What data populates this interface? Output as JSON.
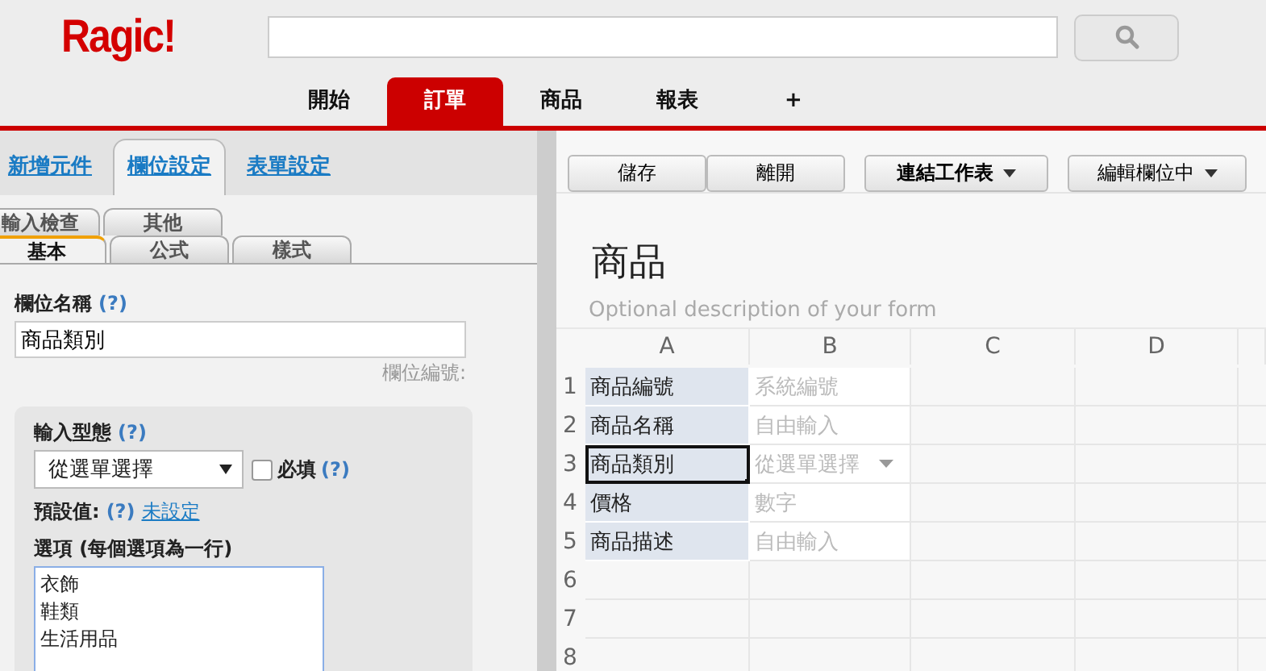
{
  "header": {
    "logo": "Ragic!"
  },
  "nav_tabs": [
    {
      "label": "開始",
      "selected": false
    },
    {
      "label": "訂單",
      "selected": true
    },
    {
      "label": "商品",
      "selected": false
    },
    {
      "label": "報表",
      "selected": false
    },
    {
      "label": "+",
      "selected": false
    }
  ],
  "left_panel": {
    "tabs": [
      {
        "label": "新增元件",
        "selected": false
      },
      {
        "label": "欄位設定",
        "selected": true
      },
      {
        "label": "表單設定",
        "selected": false
      }
    ],
    "subtab_rows": [
      [
        {
          "label": "輸入檢查",
          "selected": false
        },
        {
          "label": "其他",
          "selected": false
        }
      ],
      [
        {
          "label": "基本",
          "selected": true
        },
        {
          "label": "公式",
          "selected": false
        },
        {
          "label": "樣式",
          "selected": false
        }
      ]
    ],
    "field_name": {
      "label": "欄位名稱",
      "help": "(?)",
      "value": "商品類別",
      "note": "欄位編號:"
    },
    "input_type": {
      "label": "輸入型態",
      "help": "(?)",
      "value": "從選單選擇",
      "required": {
        "label": "必填",
        "checked": false,
        "help": "(?)"
      }
    },
    "default_value": {
      "label": "預設值:",
      "help": "(?)",
      "link": "未設定"
    },
    "options": {
      "label": "選項 (每個選項為一行)",
      "lines": [
        "衣飾",
        "鞋類",
        "生活用品"
      ]
    }
  },
  "toolbar": [
    {
      "label": "儲存",
      "dropdown": false
    },
    {
      "label": "離開",
      "dropdown": false
    },
    {
      "label": "連結工作表",
      "dropdown": true
    },
    {
      "label": "編輯欄位中",
      "dropdown": true
    }
  ],
  "form": {
    "title": "商品",
    "description": "Optional description of your form"
  },
  "sheet": {
    "columns": [
      "A",
      "B",
      "C",
      "D"
    ],
    "rows": [
      {
        "number": "1",
        "cells": [
          {
            "text": "商品編號",
            "kind": "label",
            "selected": false
          },
          {
            "text": "系統編號",
            "kind": "hint",
            "selected": false
          }
        ]
      },
      {
        "number": "2",
        "cells": [
          {
            "text": "商品名稱",
            "kind": "label",
            "selected": false
          },
          {
            "text": "自由輸入",
            "kind": "hint",
            "selected": false
          }
        ]
      },
      {
        "number": "3",
        "cells": [
          {
            "text": "商品類別",
            "kind": "label",
            "selected": true
          },
          {
            "text": "從選單選擇",
            "kind": "select",
            "selected": false
          }
        ]
      },
      {
        "number": "4",
        "cells": [
          {
            "text": "價格",
            "kind": "label",
            "selected": false
          },
          {
            "text": "數字",
            "kind": "hint",
            "selected": false
          }
        ]
      },
      {
        "number": "5",
        "cells": [
          {
            "text": "商品描述",
            "kind": "label",
            "selected": false
          },
          {
            "text": "自由輸入",
            "kind": "hint",
            "selected": false
          }
        ]
      },
      {
        "number": "6",
        "cells": []
      },
      {
        "number": "7",
        "cells": []
      },
      {
        "number": "8",
        "cells": []
      }
    ]
  }
}
